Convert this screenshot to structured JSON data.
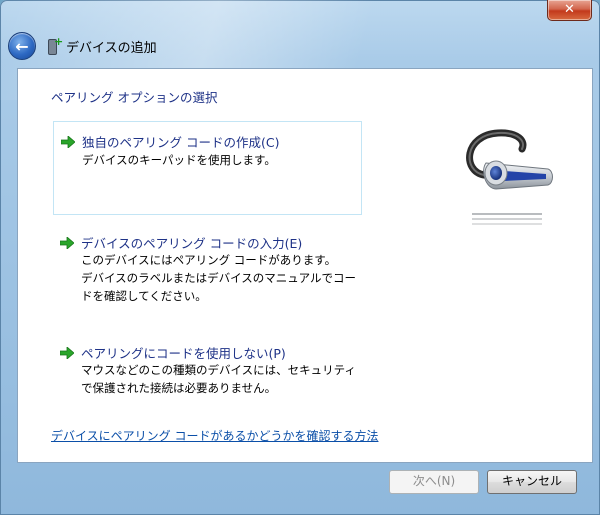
{
  "window": {
    "title": "デバイスの追加",
    "close_label": "✕"
  },
  "content": {
    "heading": "ペアリング オプションの選択",
    "options": [
      {
        "title": "独自のペアリング コードの作成(C)",
        "desc": "デバイスのキーパッドを使用します。"
      },
      {
        "title": "デバイスのペアリング コードの入力(E)",
        "desc": "このデバイスにはペアリング コードがあります。\nデバイスのラベルまたはデバイスのマニュアルでコー\nドを確認してください。"
      },
      {
        "title": "ペアリングにコードを使用しない(P)",
        "desc": "マウスなどのこの種類のデバイスには、セキュリティ\nで保護された接続は必要ありません。"
      }
    ],
    "help_link": "デバイスにペアリング コードがあるかどうかを確認する方法"
  },
  "buttons": {
    "next": "次へ(N)",
    "cancel": "キャンセル"
  },
  "icons": {
    "back": "back-arrow-icon",
    "title": "bluetooth-device-add-icon",
    "option_arrow": "green-arrow-icon",
    "device": "headset-icon"
  },
  "colors": {
    "link": "#1e3287",
    "arrow": "#2aa52a"
  }
}
